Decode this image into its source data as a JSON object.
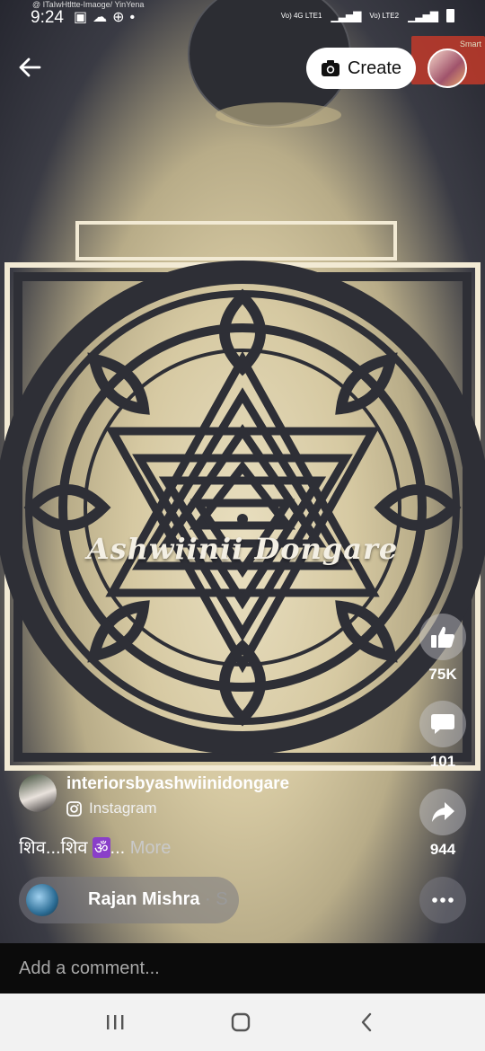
{
  "status_bar": {
    "time": "9:24",
    "notification_text": "@ ITaIwHtltte-Imaoge/ YinYena",
    "left_icons": [
      "image-icon",
      "cloud-icon",
      "grid-icon",
      "dot-icon"
    ],
    "network1": "Vo) 4G LTE1",
    "network2": "Vo) LTE2"
  },
  "header": {
    "create_label": "Create",
    "badge_text": "Smart"
  },
  "video": {
    "watermark": "Ashwiinii Dongare"
  },
  "actions": {
    "like_count": "75K",
    "comment_count": "101",
    "share_count": "944"
  },
  "author": {
    "name": "interiorsbyashwiinidongare",
    "source": "Instagram"
  },
  "caption": {
    "text": "शिव...शिव ",
    "emoji": "ॐ",
    "ellipsis": "...",
    "more": " More"
  },
  "audio": {
    "name": "Rajan Mishra",
    "suffix": " · S"
  },
  "comment": {
    "placeholder": "Add a comment..."
  },
  "colors": {
    "accent_white": "#ffffff",
    "comment_bar": "#0b0b0b",
    "nav_bar": "#f2f2f2"
  }
}
